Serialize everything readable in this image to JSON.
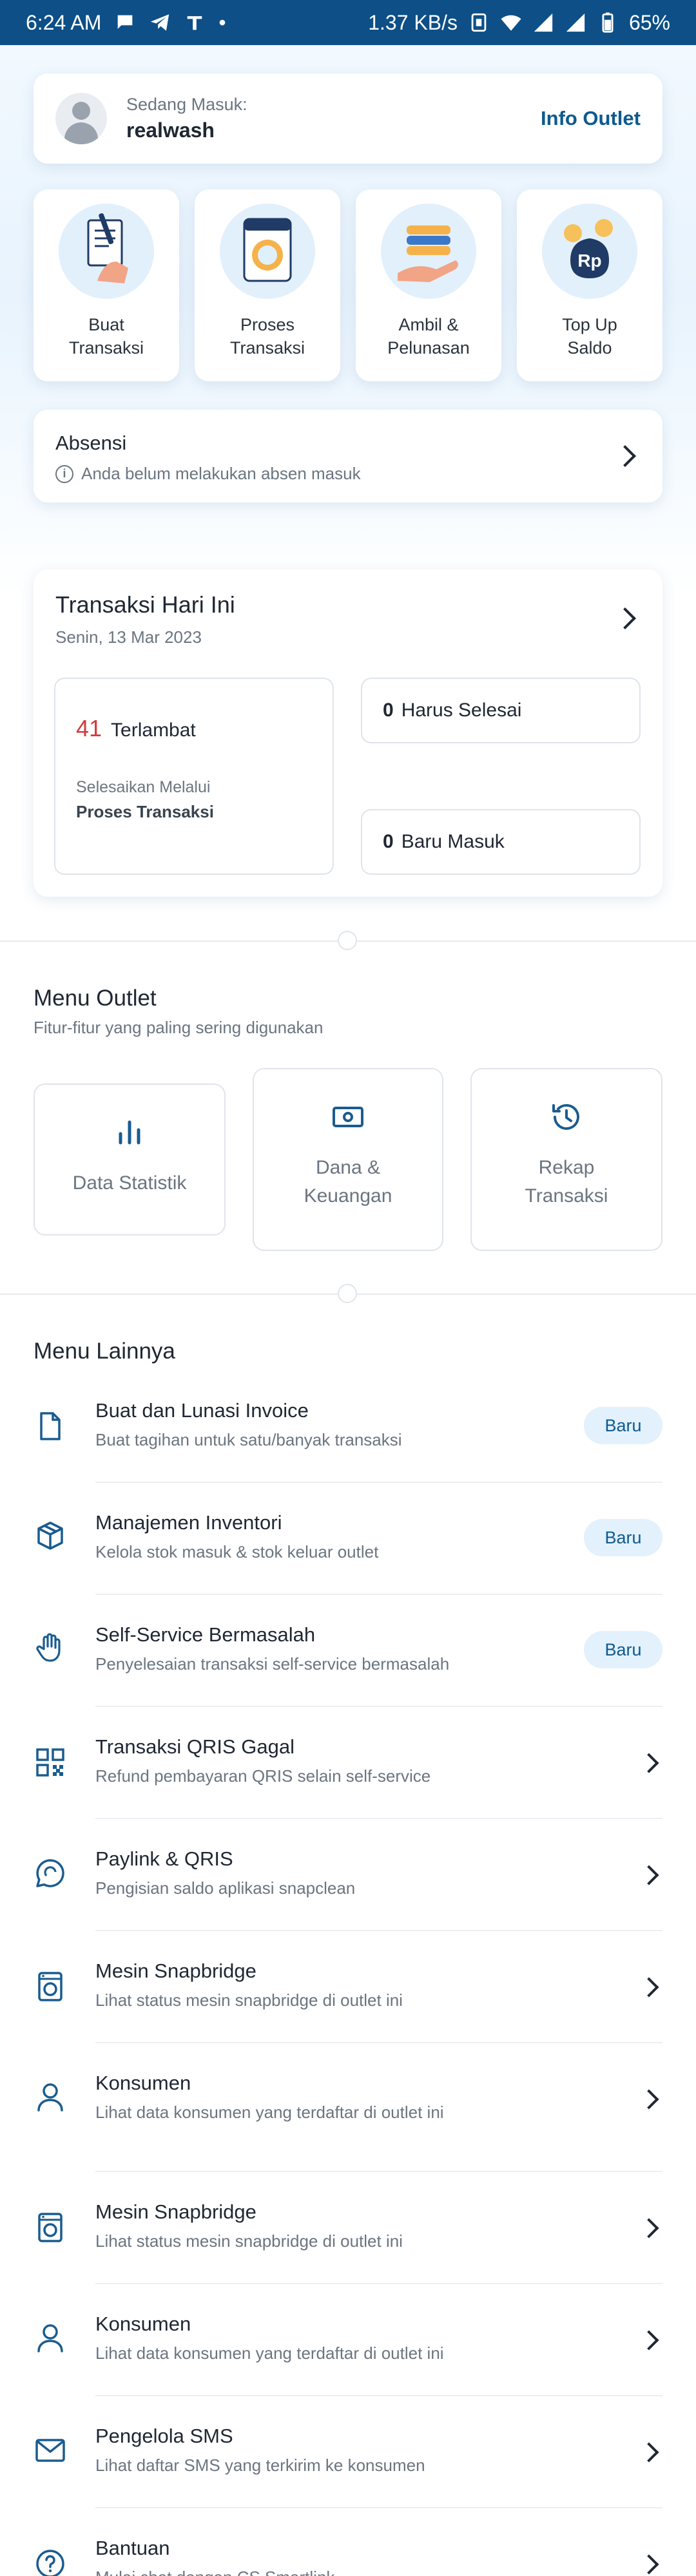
{
  "status_bar": {
    "time": "6:24 AM",
    "net_speed": "1.37 KB/s",
    "battery": "65%",
    "dot": "•"
  },
  "login": {
    "label": "Sedang Masuk:",
    "username": "realwash",
    "info_button": "Info Outlet"
  },
  "tiles": [
    {
      "label": "Buat\nTransaksi",
      "icon": "create-transaction-icon"
    },
    {
      "label": "Proses\nTransaksi",
      "icon": "washing-machine-icon"
    },
    {
      "label": "Ambil &\nPelunasan",
      "icon": "folded-laundry-icon"
    },
    {
      "label": "Top Up\nSaldo",
      "icon": "rp-coin-bag-icon"
    }
  ],
  "absensi": {
    "title": "Absensi",
    "message": "Anda belum melakukan absen masuk",
    "info_glyph": "i"
  },
  "transaksi": {
    "title": "Transaksi Hari Ini",
    "date": "Senin, 13 Mar 2023",
    "late_count": "41",
    "late_label": "Terlambat",
    "late_hint": "Selesaikan Melalui",
    "late_link": "Proses Transaksi",
    "must_finish_count": "0",
    "must_finish_label": "Harus Selesai",
    "new_count": "0",
    "new_label": "Baru Masuk"
  },
  "menu_outlet": {
    "title": "Menu Outlet",
    "subtitle": "Fitur-fitur yang paling sering digunakan",
    "items": [
      {
        "label": "Data Statistik",
        "icon": "bar-chart-icon"
      },
      {
        "label": "Dana &\nKeuangan",
        "icon": "cash-icon"
      },
      {
        "label": "Rekap\nTransaksi",
        "icon": "history-icon"
      }
    ]
  },
  "menu_lainnya": {
    "title": "Menu Lainnya",
    "badge": "Baru",
    "items": [
      {
        "title": "Buat dan Lunasi Invoice",
        "subtitle": "Buat tagihan untuk satu/banyak transaksi",
        "icon": "document-icon",
        "badge": true
      },
      {
        "title": "Manajemen Inventori",
        "subtitle": "Kelola stok masuk & stok keluar outlet",
        "icon": "box-icon",
        "badge": true
      },
      {
        "title": "Self-Service Bermasalah",
        "subtitle": "Penyelesaian transaksi self-service bermasalah",
        "icon": "hand-stop-icon",
        "badge": true
      },
      {
        "title": "Transaksi QRIS Gagal",
        "subtitle": "Refund pembayaran QRIS selain self-service",
        "icon": "qr-code-icon",
        "badge": false
      },
      {
        "title": "Paylink & QRIS",
        "subtitle": "Pengisian saldo aplikasi snapclean",
        "icon": "chat-bubble-icon",
        "badge": false
      },
      {
        "title": "Mesin Snapbridge",
        "subtitle": "Lihat status mesin snapbridge di outlet ini",
        "icon": "washing-machine-icon",
        "badge": false
      },
      {
        "title": "Konsumen",
        "subtitle": "Lihat data konsumen yang terdaftar di outlet ini",
        "icon": "user-icon",
        "badge": false
      },
      {
        "title": "Mesin Snapbridge",
        "subtitle": "Lihat status mesin snapbridge di outlet ini",
        "icon": "washing-machine-icon",
        "badge": false
      },
      {
        "title": "Konsumen",
        "subtitle": "Lihat data konsumen yang terdaftar di outlet ini",
        "icon": "user-icon",
        "badge": false
      },
      {
        "title": "Pengelola SMS",
        "subtitle": "Lihat daftar SMS yang terkirim ke konsumen",
        "icon": "mail-icon",
        "badge": false
      },
      {
        "title": "Bantuan",
        "subtitle": "Mulai chat dengan CS Smartlink",
        "icon": "help-circle-icon",
        "badge": false
      }
    ]
  },
  "colors": {
    "status_bar": "#0d4f86",
    "accent": "#0d5a8f",
    "late": "#d23a3a",
    "badge_bg": "#e3f1fc"
  }
}
